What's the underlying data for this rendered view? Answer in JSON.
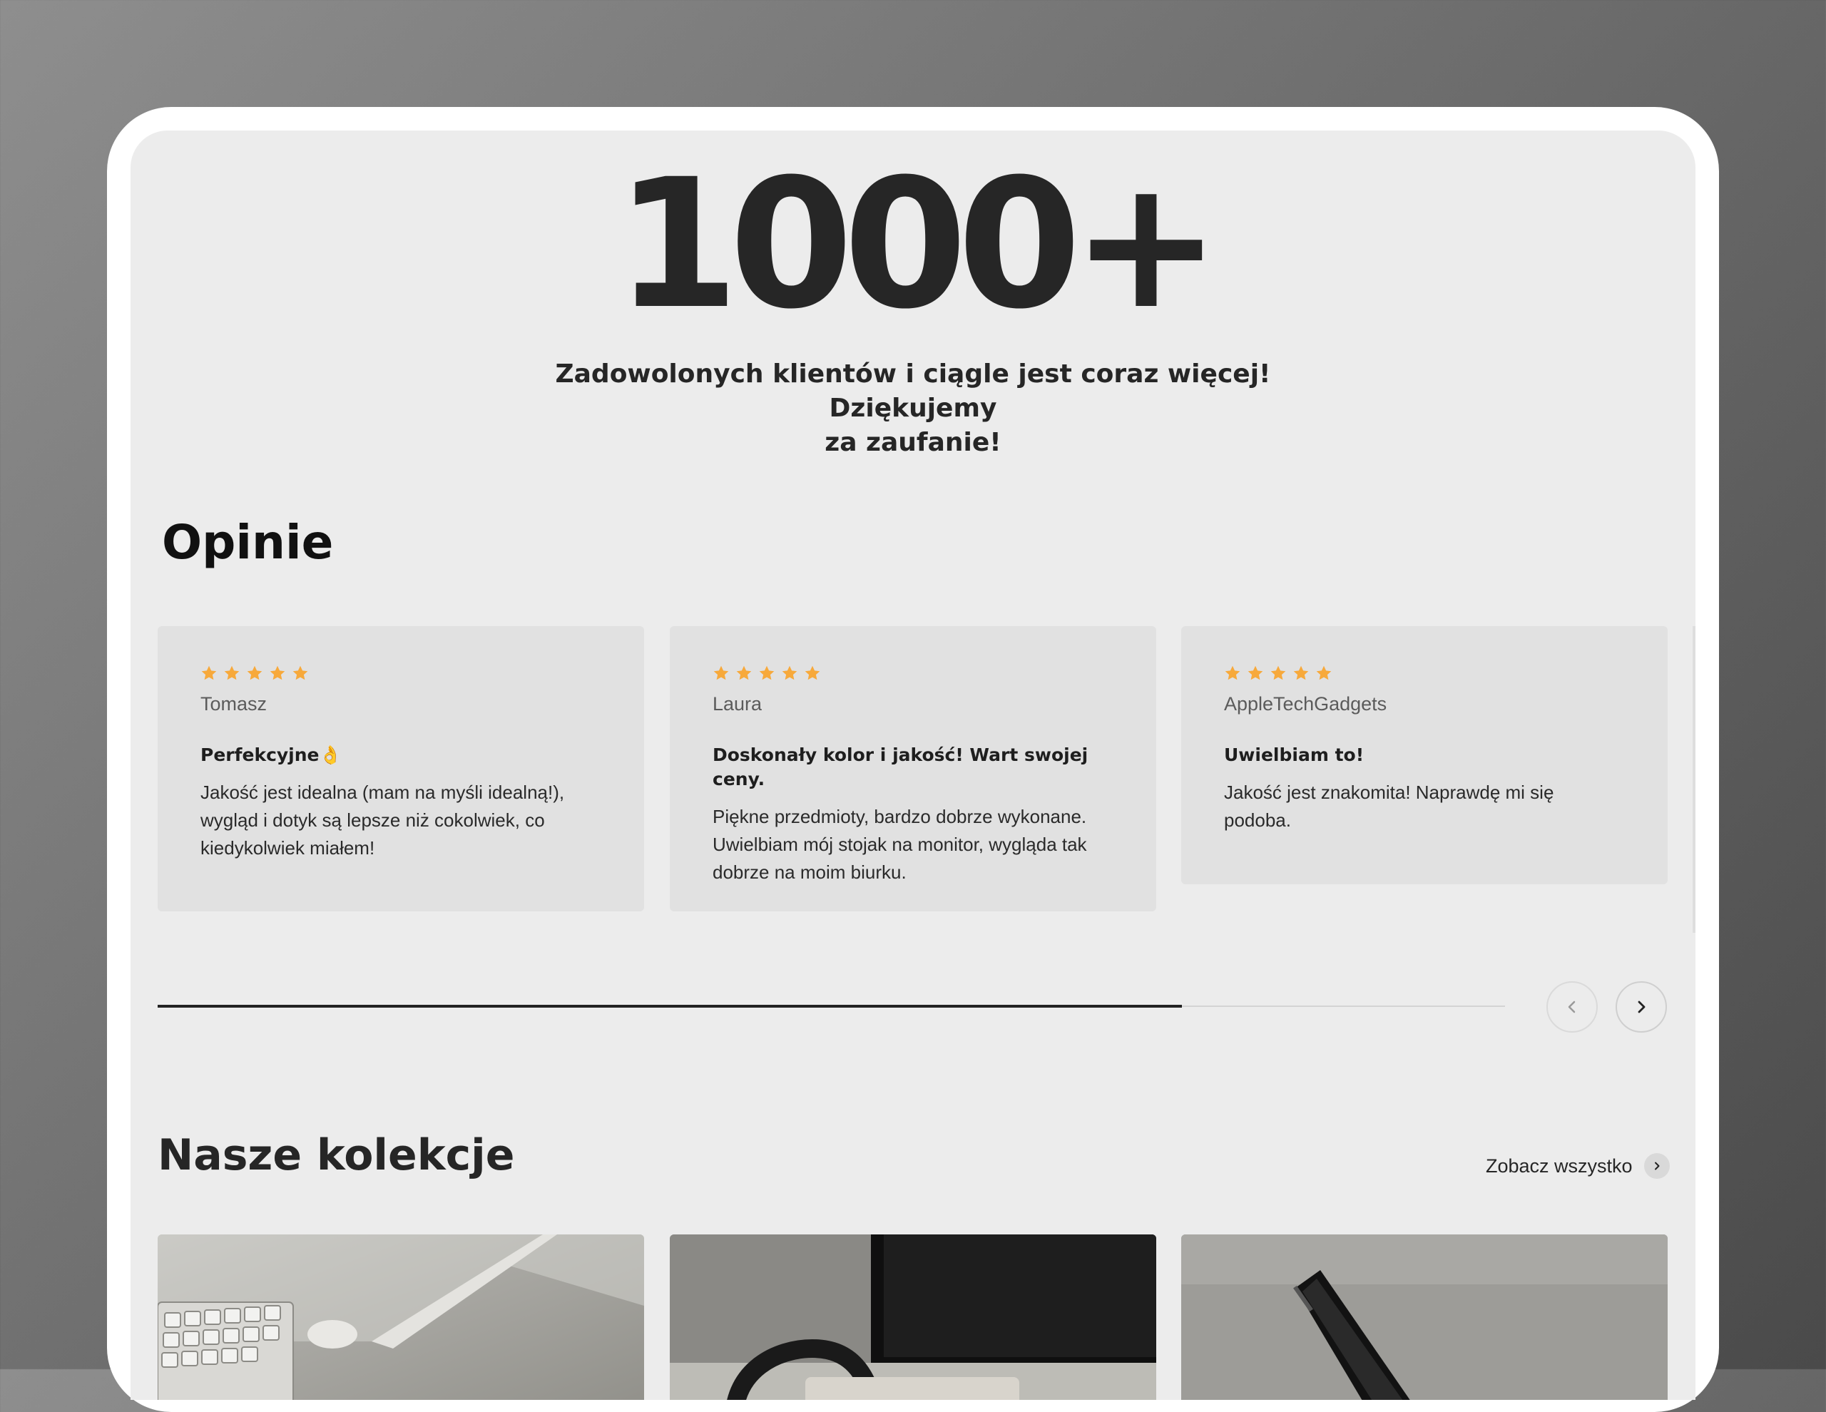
{
  "stats": {
    "number": "1000+",
    "caption_line1": "Zadowolonych klientów i ciągle jest coraz więcej! Dziękujemy",
    "caption_line2": "za zaufanie!"
  },
  "reviews": {
    "title": "Opinie",
    "star_color": "#f7a93b",
    "items": [
      {
        "rating": 5,
        "author": "Tomasz",
        "title": "Perfekcyjne",
        "title_emoji": "👌",
        "body": "Jakość jest idealna (mam na myśli idealną!), wygląd i dotyk są lepsze niż cokolwiek, co kiedykolwiek miałem!"
      },
      {
        "rating": 5,
        "author": "Laura",
        "title": "Doskonały kolor i jakość! Wart swojej ceny.",
        "body": "Piękne przedmioty, bardzo dobrze wykonane. Uwielbiam mój stojak na monitor, wygląda tak dobrze na moim biurku."
      },
      {
        "rating": 5,
        "author": "AppleTechGadgets",
        "title": "Uwielbiam to!",
        "body": "Jakość jest znakomita! Naprawdę mi się podoba."
      }
    ],
    "scroll_progress": 0.76
  },
  "collections": {
    "title": "Nasze kolekcje",
    "see_all_label": "Zobacz wszystko"
  }
}
